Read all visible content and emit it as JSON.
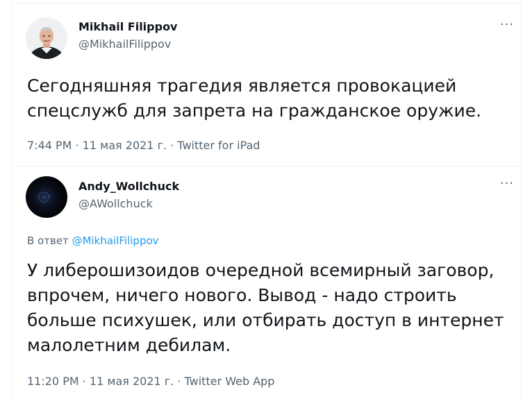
{
  "tweets": [
    {
      "author_name": "Mikhail Filippov",
      "author_handle": "@MikhailFilippov",
      "more_icon": "more-horizontal-icon",
      "text": "Сегодняшняя трагедия является провокацией\nспецслужб для запрета на гражданское оружие.",
      "time": "7:44 PM",
      "sep1": " · ",
      "date": "11 мая 2021 г.",
      "sep2": " · ",
      "source": "Twitter for iPad"
    },
    {
      "author_name": "Andy_Wollchuck",
      "author_handle": "@AWollchuck",
      "more_icon": "more-horizontal-icon",
      "reply_prefix": "В ответ ",
      "reply_mention": "@MikhailFilippov",
      "text": "У либерошизоидов очередной всемирный заговор,\nвпрочем, ничего нового. Вывод - надо строить\nбольше психушек, или отбирать доступ в интернет\nмалолетним дебилам.",
      "time": "11:20 PM",
      "sep1": " · ",
      "date": "11 мая 2021 г.",
      "sep2": " · ",
      "source": "Twitter Web App"
    }
  ],
  "colors": {
    "text_primary": "#0f1419",
    "text_secondary": "#536471",
    "link": "#1d9bf0",
    "border": "#eff3f4"
  }
}
